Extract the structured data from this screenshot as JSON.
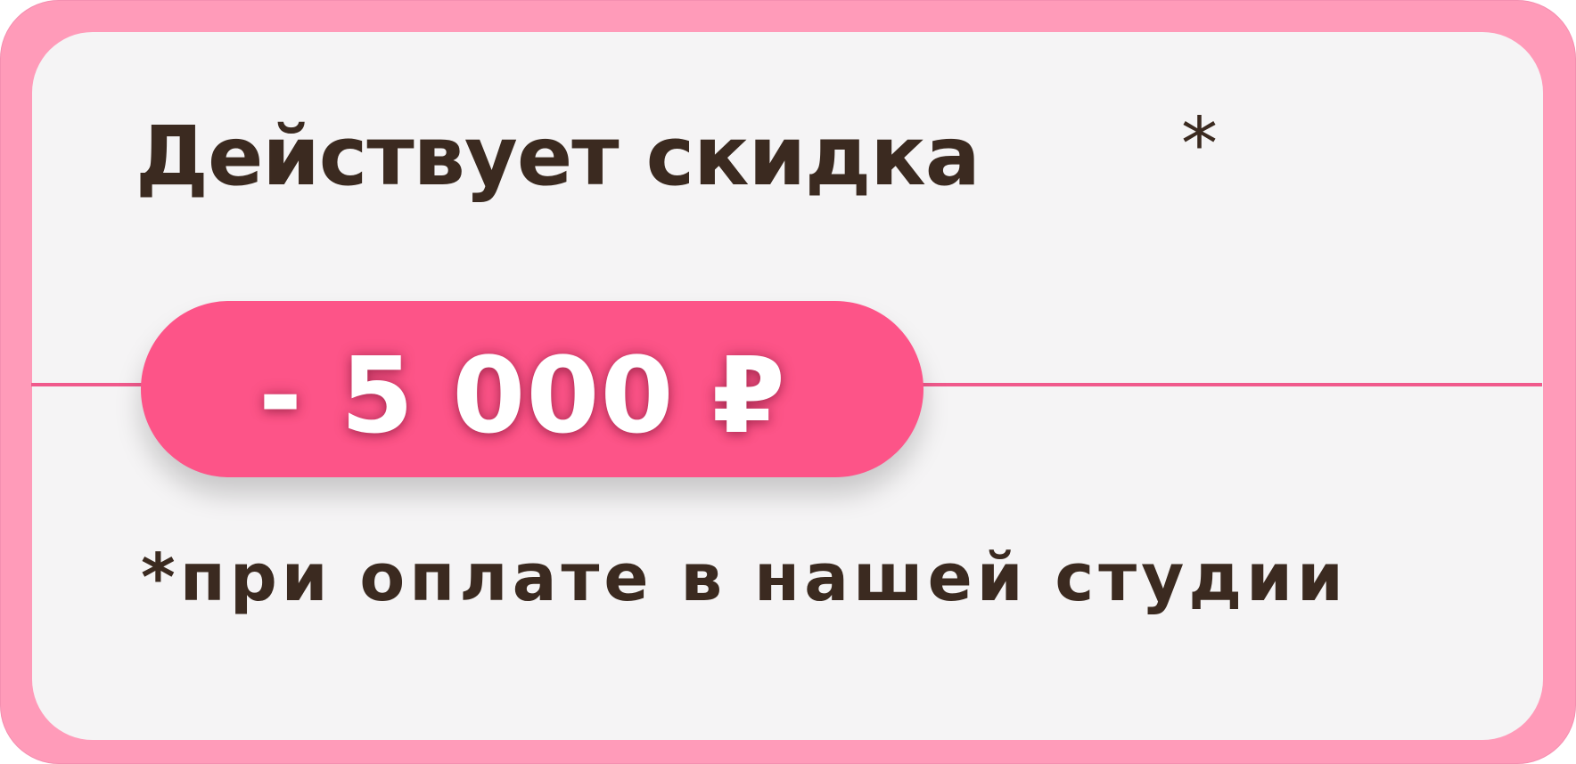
{
  "banner": {
    "heading": "Действует скидка",
    "asterisk": "*",
    "discount": "- 5 000 ₽",
    "footnote": "*при оплате в нашей студии"
  },
  "colors": {
    "frame": "#ff9bb9",
    "card": "#f5f4f5",
    "accent": "#fd5488",
    "text": "#3b2a20",
    "discount_text": "#ffffff"
  }
}
